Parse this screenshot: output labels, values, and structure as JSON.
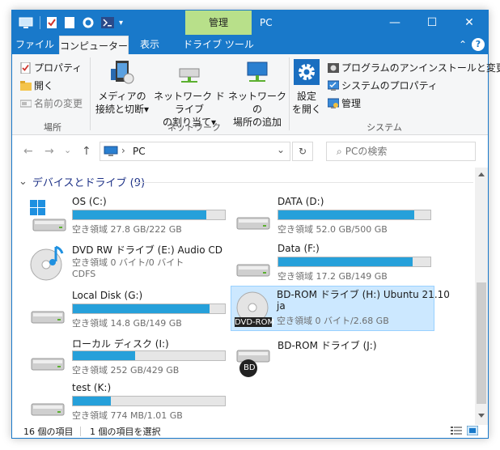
{
  "window": {
    "context_tab": "管理",
    "title": "PC",
    "minimize_glyph": "—",
    "maximize_glyph": "☐",
    "close_glyph": "✕"
  },
  "tabs": {
    "file": "ファイル",
    "computer": "コンピューター",
    "view": "表示",
    "drive_tools": "ドライブ ツール",
    "help_glyph": "?",
    "collapse_glyph": "⌃"
  },
  "ribbon": {
    "location": {
      "properties": "プロパティ",
      "open": "開く",
      "rename": "名前の変更",
      "label": "場所"
    },
    "network": {
      "media_line1": "メディアの",
      "media_line2": "接続と切断",
      "map_line1": "ネットワーク ドライブ",
      "map_line2": "の割り当て",
      "add_line1": "ネットワークの",
      "add_line2": "場所の追加",
      "label": "ネットワーク"
    },
    "system": {
      "settings_line1": "設定",
      "settings_line2": "を開く",
      "uninstall": "プログラムのアンインストールと変更",
      "sys_props": "システムのプロパティ",
      "manage": "管理",
      "label": "システム"
    },
    "dropdown_glyph": "▾"
  },
  "address": {
    "back_glyph": "←",
    "forward_glyph": "→",
    "history_glyph": "⌄",
    "up_glyph": "↑",
    "sep_glyph": "›",
    "path": "PC",
    "dropdown_glyph": "⌄",
    "refresh_glyph": "↻",
    "search_glyph": "⌕",
    "search_placeholder": "PCの検索"
  },
  "group": {
    "chevron": "⌄",
    "title": "デバイスとドライブ (9)"
  },
  "drives": [
    {
      "name": "OS (C:)",
      "free": "空き領域 27.8 GB/222 GB",
      "used_fraction": 0.875,
      "icon": "windows-drive-icon"
    },
    {
      "name": "DATA (D:)",
      "free": "空き領域 52.0 GB/500 GB",
      "used_fraction": 0.896,
      "icon": "hard-drive-icon"
    },
    {
      "name": "DVD RW ドライブ (E:) Audio CD",
      "free": "空き領域 0 バイト/0 バイト",
      "sub": "CDFS",
      "icon": "audio-cd-icon"
    },
    {
      "name": "Data (F:)",
      "free": "空き領域 17.2 GB/149 GB",
      "used_fraction": 0.885,
      "icon": "hard-drive-icon"
    },
    {
      "name": "Local Disk (G:)",
      "free": "空き領域 14.8 GB/149 GB",
      "used_fraction": 0.9,
      "icon": "hard-drive-icon"
    },
    {
      "name": "BD-ROM ドライブ (H:) Ubuntu 21.10",
      "name2": "ja",
      "free": "空き領域 0 バイト/2.68 GB",
      "icon": "dvd-rom-icon",
      "badge": "DVD-ROM"
    },
    {
      "name": "ローカル ディスク (I:)",
      "free": "空き領域 252 GB/429 GB",
      "used_fraction": 0.41,
      "icon": "hard-drive-icon"
    },
    {
      "name": "BD-ROM ドライブ (J:)",
      "icon": "bd-rom-icon",
      "badge": "BD"
    },
    {
      "name": "test (K:)",
      "free": "空き領域 774 MB/1.01 GB",
      "used_fraction": 0.25,
      "icon": "hard-drive-icon"
    }
  ],
  "status": {
    "count": "16 個の項目",
    "selected": "1 個の項目を選択"
  },
  "colors": {
    "accent": "#1979ca",
    "context_tab": "#b8e08a",
    "bar_fill": "#26a0da",
    "selection": "#cce8ff"
  }
}
